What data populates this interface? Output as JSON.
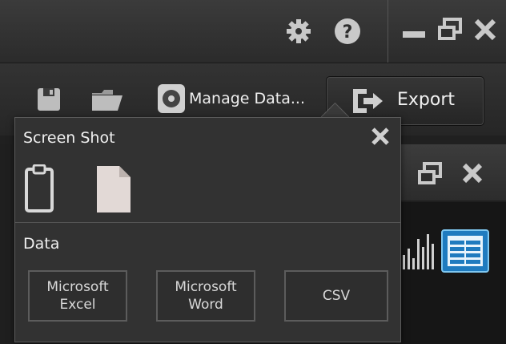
{
  "icons": {
    "settings": "gear-icon",
    "help": "help-icon",
    "minimize": "minimize-icon",
    "restore": "restore-icon",
    "close": "close-icon",
    "save": "save-icon",
    "open": "folder-icon",
    "manage_data": "manage-data-icon",
    "export": "export-icon",
    "clipboard": "clipboard-icon",
    "file": "file-icon",
    "bar_chart": "bar-chart-icon",
    "table_view": "table-icon"
  },
  "titlebar": {
    "help_glyph": "?"
  },
  "toolbar": {
    "manage_data_label": "Manage Data...",
    "export_label": "Export"
  },
  "popup": {
    "title": "Screen Shot",
    "data_section_label": "Data",
    "buttons": [
      {
        "label": "Microsoft\nExcel"
      },
      {
        "label": "Microsoft\nWord"
      },
      {
        "label": "CSV"
      }
    ]
  },
  "colors": {
    "accent_blue": "#1f7bbf",
    "accent_border": "#7fc7f0"
  }
}
